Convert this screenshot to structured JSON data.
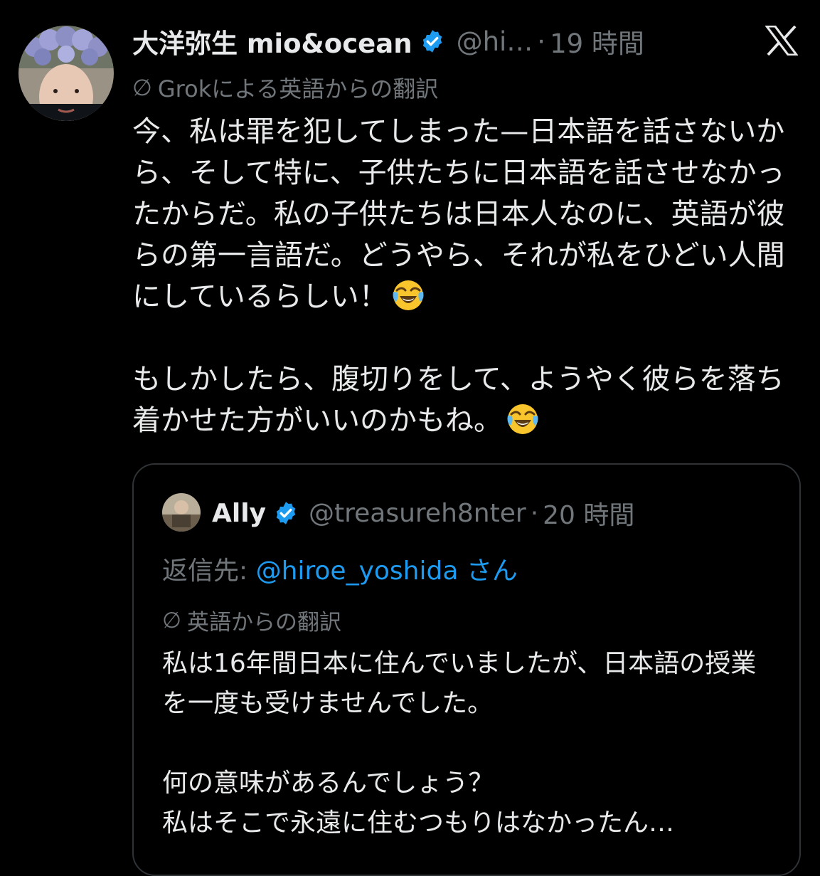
{
  "tweet": {
    "avatar_icon": "user-avatar-flower-crown",
    "display_name": "大洋弥生 mio&ocean",
    "verified_icon": "verified-badge-icon",
    "handle": "@hi…",
    "dot": "·",
    "time": "19 時間",
    "close_icon": "x-logo-icon",
    "translation_glyph": "∅",
    "translation_label": "Grokによる英語からの翻訳",
    "paragraphs": [
      "今、私は罪を犯してしまった—日本語を話さないから、そして特に、子供たちに日本語を話させなかったからだ。私の子供たちは日本人なのに、英語が彼らの第一言語だ。どうやら、それが私をひどい人間にしているらしい！",
      "もしかしたら、腹切りをして、ようやく彼らを落ち着かせた方がいいのかもね。"
    ],
    "emoji_icon": "tears-of-joy-emoji"
  },
  "quote": {
    "avatar_icon": "quoted-user-avatar",
    "display_name": "Ally",
    "handle": "@treasureh8nter",
    "dot": "·",
    "time": "20 時間",
    "reply_prefix": "返信先: ",
    "reply_handle": "@hiroe_yoshida",
    "reply_suffix": " さん",
    "translation_glyph": "∅",
    "translation_label": "英語からの翻訳",
    "paragraphs": [
      "私は16年間日本に住んでいましたが、日本語の授業を一度も受けませんでした。",
      "何の意味があるんでしょう？\n私はそこで永遠に住むつもりはなかったん…"
    ]
  },
  "colors": {
    "background": "#000000",
    "text_primary": "#e7e9ea",
    "text_secondary": "#71767b",
    "link": "#1d9bf0",
    "verified": "#1d9bf0",
    "border": "#2f3336"
  }
}
